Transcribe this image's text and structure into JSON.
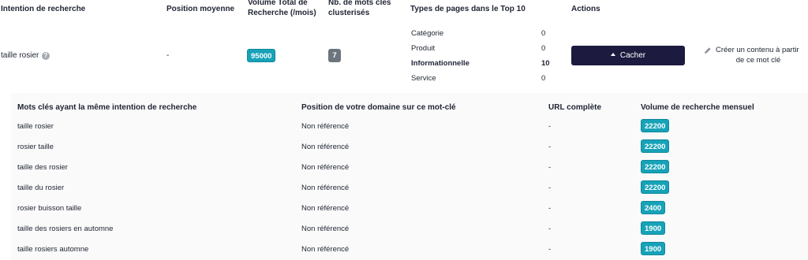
{
  "main_table": {
    "headers": {
      "intention": "Intention de recherche",
      "position": "Position moyenne",
      "volume_line1": "Volume Total de",
      "volume_line2": "Recherche (/mois)",
      "count_line1": "Nb. de mots clés",
      "count_line2": "clusterisés",
      "page_types": "Types de pages dans le Top 10",
      "actions": "Actions"
    },
    "row": {
      "intention": "taille rosier",
      "position": "-",
      "volume": "95000",
      "keyword_count": "7",
      "page_types": [
        {
          "label": "Catégorie",
          "value": "0",
          "bold": false
        },
        {
          "label": "Produit",
          "value": "0",
          "bold": false
        },
        {
          "label": "Informationnelle",
          "value": "10",
          "bold": true
        },
        {
          "label": "Service",
          "value": "0",
          "bold": false
        }
      ],
      "hide_button": "Cacher",
      "create_line1": "Créer un contenu à partir",
      "create_line2": "de ce mot clé"
    }
  },
  "sub_table": {
    "headers": {
      "keyword": "Mots clés ayant la même intention de recherche",
      "position": "Position de votre domaine sur ce mot-clé",
      "url": "URL complète",
      "volume": "Volume de recherche mensuel"
    },
    "rows": [
      {
        "keyword": "taille rosier",
        "position": "Non référencé",
        "url": "-",
        "volume": "22200"
      },
      {
        "keyword": "rosier taille",
        "position": "Non référencé",
        "url": "-",
        "volume": "22200"
      },
      {
        "keyword": "taille des rosier",
        "position": "Non référencé",
        "url": "-",
        "volume": "22200"
      },
      {
        "keyword": "taille du rosier",
        "position": "Non référencé",
        "url": "-",
        "volume": "22200"
      },
      {
        "keyword": "rosier buisson taille",
        "position": "Non référencé",
        "url": "-",
        "volume": "2400"
      },
      {
        "keyword": "taille des rosiers en automne",
        "position": "Non référencé",
        "url": "-",
        "volume": "1900"
      },
      {
        "keyword": "taille rosiers automne",
        "position": "Non référencé",
        "url": "-",
        "volume": "1900"
      }
    ]
  },
  "icons": {
    "help": "question-circle-icon",
    "pencil": "pencil-icon",
    "caret": "caret-up-icon"
  },
  "colors": {
    "badge_teal": "#17a2b8",
    "badge_gray": "#6c757d",
    "button_dark": "#1d1a3f"
  }
}
